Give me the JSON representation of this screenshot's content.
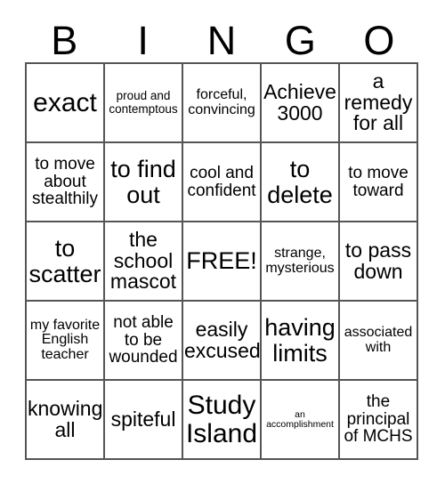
{
  "card": {
    "title_letters": [
      "B",
      "I",
      "N",
      "G",
      "O"
    ],
    "rows": [
      [
        {
          "text": "exact",
          "size": "xxl"
        },
        {
          "text": "proud and contemptous",
          "size": "xs"
        },
        {
          "text": "forceful, convincing",
          "size": "s"
        },
        {
          "text": "Achieve 3000",
          "size": "l"
        },
        {
          "text": "a remedy for all",
          "size": "l"
        }
      ],
      [
        {
          "text": "to move about stealthily",
          "size": "m"
        },
        {
          "text": "to find out",
          "size": "xl"
        },
        {
          "text": "cool and confident",
          "size": "m"
        },
        {
          "text": "to delete",
          "size": "xl"
        },
        {
          "text": "to move toward",
          "size": "m"
        }
      ],
      [
        {
          "text": "to scatter",
          "size": "xl"
        },
        {
          "text": "the school mascot",
          "size": "l"
        },
        {
          "text": "FREE!",
          "size": "xl"
        },
        {
          "text": "strange, mysterious",
          "size": "s"
        },
        {
          "text": "to pass down",
          "size": "l"
        }
      ],
      [
        {
          "text": "my favorite English teacher",
          "size": "s"
        },
        {
          "text": "not able to be wounded",
          "size": "m"
        },
        {
          "text": "easily excused",
          "size": "l"
        },
        {
          "text": "having limits",
          "size": "xl"
        },
        {
          "text": "associated with",
          "size": "s"
        }
      ],
      [
        {
          "text": "knowing all",
          "size": "l"
        },
        {
          "text": "spiteful",
          "size": "l"
        },
        {
          "text": "Study Island",
          "size": "xxl"
        },
        {
          "text": "an accomplishment",
          "size": "xxs"
        },
        {
          "text": "the principal of MCHS",
          "size": "m"
        }
      ]
    ],
    "colors": {
      "border": "#555555",
      "background": "#ffffff",
      "text": "#000000"
    }
  }
}
